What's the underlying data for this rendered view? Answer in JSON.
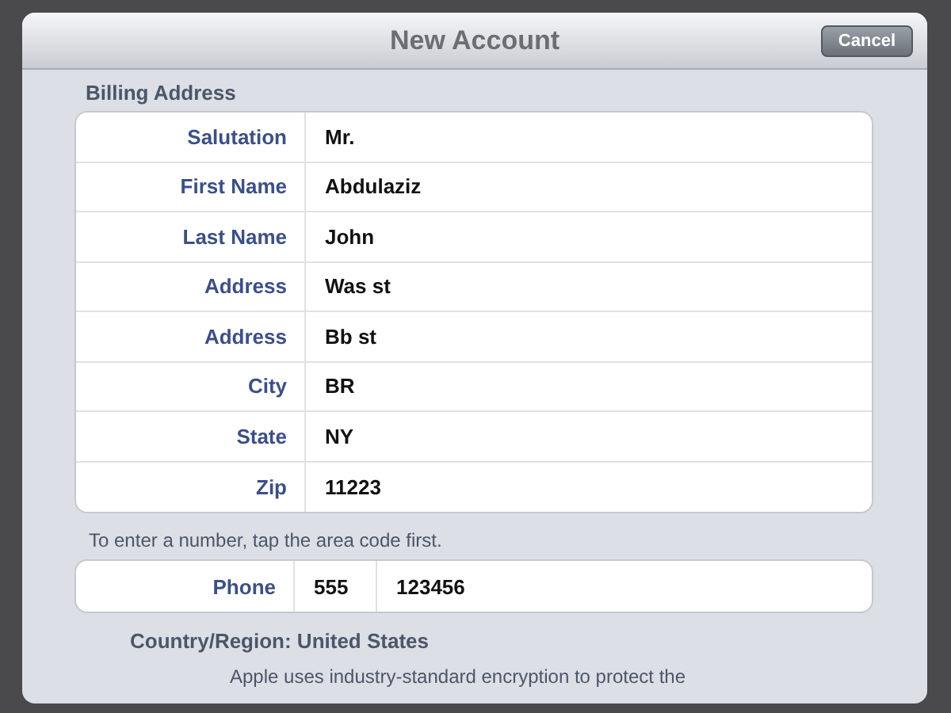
{
  "window": {
    "title": "New Account",
    "cancel_button": "Cancel"
  },
  "billing": {
    "heading": "Billing Address",
    "rows": [
      {
        "label": "Salutation",
        "value": "Mr."
      },
      {
        "label": "First Name",
        "value": "Abdulaziz"
      },
      {
        "label": "Last Name",
        "value": "John"
      },
      {
        "label": "Address",
        "value": "Was st"
      },
      {
        "label": "Address",
        "value": "Bb st"
      },
      {
        "label": "City",
        "value": "BR"
      },
      {
        "label": "State",
        "value": "NY"
      },
      {
        "label": "Zip",
        "value": "11223"
      }
    ]
  },
  "phone": {
    "hint": "To enter a number, tap the area code first.",
    "label": "Phone",
    "area_code": "555",
    "number": "123456"
  },
  "country": "Country/Region: United States",
  "footer": "Apple uses industry-standard encryption to protect the"
}
